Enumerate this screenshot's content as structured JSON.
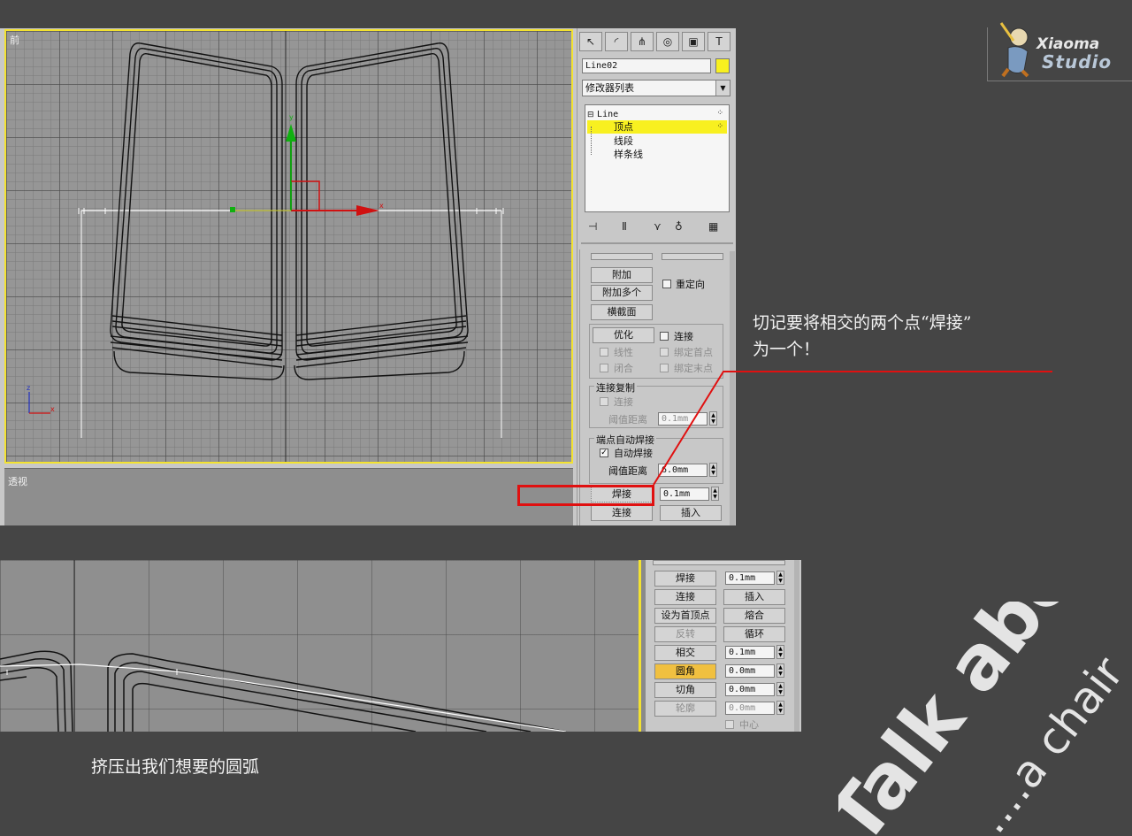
{
  "top_viewport": {
    "label": "前"
  },
  "persp_viewport": {
    "label": "透视"
  },
  "panel": {
    "tabs": [
      {
        "icon": "cursor-icon",
        "glyph": "↖"
      },
      {
        "icon": "curve-icon",
        "glyph": "◜"
      },
      {
        "icon": "hierarchy-icon",
        "glyph": "⋔"
      },
      {
        "icon": "motion-icon",
        "glyph": "◎"
      },
      {
        "icon": "display-icon",
        "glyph": "▣"
      },
      {
        "icon": "utility-icon",
        "glyph": "T"
      }
    ],
    "object_name": "Line02",
    "object_color": "#f8f020",
    "modifier_list": "修改器列表",
    "stack": {
      "root": "Line",
      "items": [
        "顶点",
        "线段",
        "样条线"
      ],
      "selected": "顶点"
    },
    "buttons": {
      "attach": "附加",
      "attach_multi": "附加多个",
      "cross_section": "横截面",
      "reorient": "重定向",
      "refine": "优化",
      "connect_chk": "连接",
      "linear": "线性",
      "bind_first": "绑定首点",
      "closed": "闭合",
      "bind_last": "绑定末点",
      "connect_copy_group": "连接复制",
      "connect_copy_chk": "连接",
      "threshold_label": "阈值距离",
      "threshold_value_1": "0.1mm",
      "endpoint_weld_group": "端点自动焊接",
      "auto_weld": "自动焊接",
      "threshold_label_2": "阈值距离",
      "threshold_value_2": "6.0mm",
      "weld": "焊接",
      "weld_value": "0.1mm",
      "connect": "连接",
      "insert": "插入"
    }
  },
  "callout": {
    "line1": "切记要将相交的两个点“焊接”",
    "line2": "为一个！"
  },
  "logo": {
    "line1": "Xiaoma",
    "line2": "Studio"
  },
  "bottom_panel": {
    "weld": "焊接",
    "weld_value": "0.1mm",
    "connect": "连接",
    "insert": "插入",
    "make_first": "设为首顶点",
    "fuse": "熔合",
    "reverse": "反转",
    "cycle": "循环",
    "intersect": "相交",
    "intersect_value": "0.1mm",
    "fillet": "圆角",
    "fillet_value": "0.0mm",
    "chamfer": "切角",
    "chamfer_value": "0.0mm",
    "outline": "轮廓",
    "outline_value": "0.0mm",
    "center": "中心"
  },
  "caption": "挤压出我们想要的圆弧",
  "decoration": {
    "text1": "Talk about",
    "text2": "....a chair"
  },
  "colors": {
    "highlight": "#e01010",
    "selected_row": "#f8f020",
    "fillet_active": "#f0c040"
  }
}
